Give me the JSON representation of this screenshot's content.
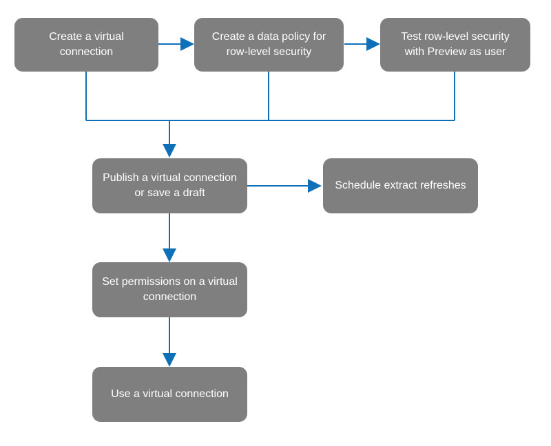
{
  "nodes": {
    "create_vc": "Create a virtual connection",
    "create_policy": "Create a data policy for row-level security",
    "test_rls": "Test row-level security with Preview as user",
    "publish": "Publish a virtual connection or save a draft",
    "schedule": "Schedule extract refreshes",
    "permissions": "Set permissions on a virtual connection",
    "use_vc": "Use a virtual connection"
  },
  "flow": {
    "edges": [
      [
        "create_vc",
        "create_policy"
      ],
      [
        "create_policy",
        "test_rls"
      ],
      [
        "create_vc",
        "publish"
      ],
      [
        "create_policy",
        "publish"
      ],
      [
        "test_rls",
        "publish"
      ],
      [
        "publish",
        "schedule"
      ],
      [
        "publish",
        "permissions"
      ],
      [
        "permissions",
        "use_vc"
      ]
    ],
    "description": "Workflow: Three top steps feed into Publish. Publish branches to Schedule extract refreshes, and continues down to Set permissions, then Use a virtual connection."
  },
  "style": {
    "box_color": "#7f7f7f",
    "text_color": "#ffffff",
    "arrow_color": "#0f6fb7"
  }
}
